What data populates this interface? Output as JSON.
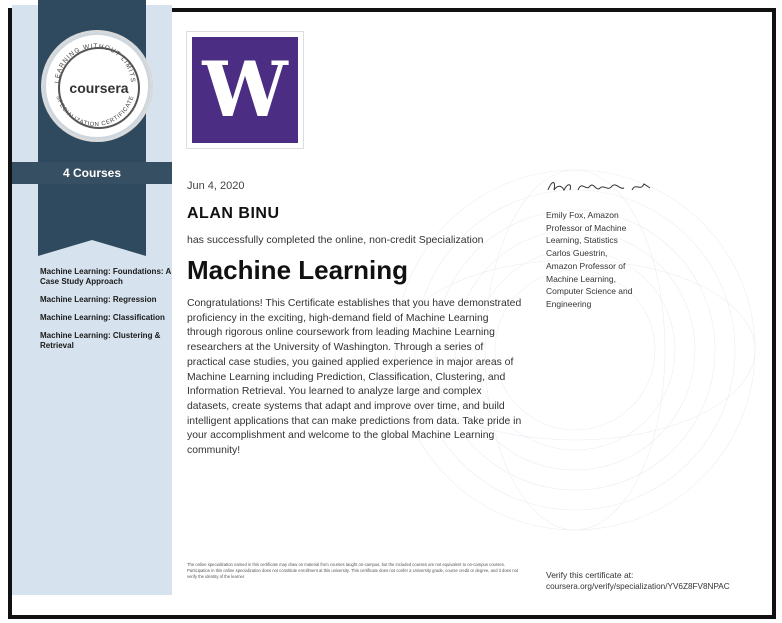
{
  "seal": {
    "brand": "coursera",
    "ring_text_top": "LEARNING WITHOUT LIMITS",
    "ring_text_bottom": "SPECIALIZATION CERTIFICATE",
    "icon": "coursera-seal-icon"
  },
  "sidebar": {
    "courses_count": "4 Courses",
    "courses": [
      {
        "name": "Machine Learning: Foundations: A Case Study Approach"
      },
      {
        "name": "Machine Learning: Regression"
      },
      {
        "name": "Machine Learning: Classification"
      },
      {
        "name": "Machine Learning: Clustering & Retrieval"
      }
    ]
  },
  "logo": {
    "letter": "W",
    "icon": "university-of-washington-logo",
    "color": "#4b2e83"
  },
  "certificate": {
    "date": "Jun 4, 2020",
    "recipient": "ALAN BINU",
    "completed_line": "has successfully completed the online, non-credit Specialization",
    "title": "Machine Learning",
    "body": "Congratulations! This Certificate establishes that you have demonstrated proficiency in the exciting, high-demand field of Machine Learning through rigorous online coursework from leading Machine Learning researchers at the University of Washington. Through a series of practical case studies, you gained applied experience in major areas of Machine Learning including Prediction, Classification, Clustering, and Information Retrieval. You learned to analyze large and complex datasets, create systems that adapt and improve over time, and build intelligent applications that can make predictions from data. Take pride in your accomplishment and welcome to the global Machine Learning community!"
  },
  "signers": {
    "signature_icon": "signature-icon",
    "line1": "Emily Fox, Amazon",
    "line2": "Professor of Machine",
    "line3": "Learning, Statistics",
    "line4": "Carlos Guestrin,",
    "line5": "Amazon Professor of",
    "line6": "Machine Learning,",
    "line7": "Computer Science and",
    "line8": "Engineering"
  },
  "fine_print": "The online specialization named in this certificate may draw on material from courses taught on-campus, but the included courses are not equivalent to on-campus courses. Participation in this online specialization does not constitute enrollment at this university. This certificate does not confer a University grade, course credit or degree, and it does not verify the identity of the learner.",
  "verify": {
    "label": "Verify this certificate at:",
    "url": "coursera.org/verify/specialization/YV6Z8FV8NPAC"
  },
  "colors": {
    "sidebar": "#d6e2ee",
    "ribbon": "#2f4a5e",
    "uw_purple": "#4b2e83"
  }
}
